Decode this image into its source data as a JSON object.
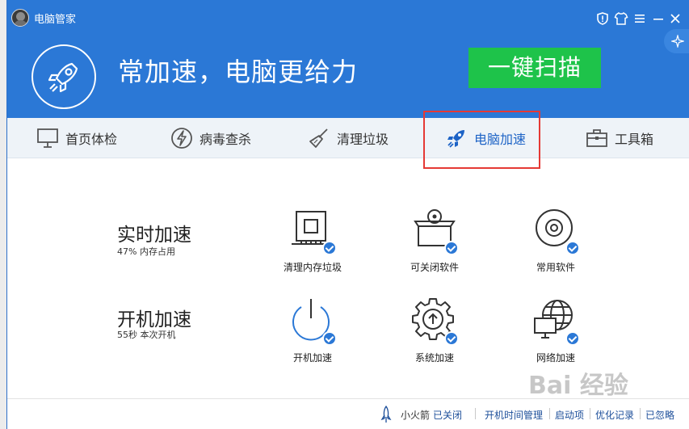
{
  "titlebar": {
    "title": "电脑管家"
  },
  "hero": {
    "slogan": "常加速，电脑更给力",
    "scan_button": "一键扫描"
  },
  "nav": {
    "items": [
      {
        "label": "首页体检",
        "icon": "monitor-icon"
      },
      {
        "label": "病毒查杀",
        "icon": "lightning-icon"
      },
      {
        "label": "清理垃圾",
        "icon": "broom-icon"
      },
      {
        "label": "电脑加速",
        "icon": "rocket-icon",
        "active": true
      },
      {
        "label": "工具箱",
        "icon": "toolbox-icon"
      }
    ]
  },
  "realtime": {
    "title": "实时加速",
    "subtitle": "47% 内存占用"
  },
  "boot": {
    "title": "开机加速",
    "subtitle": "55秒 本次开机"
  },
  "tools": [
    {
      "label": "清理内存垃圾",
      "icon": "memory-chip-icon"
    },
    {
      "label": "可关闭软件",
      "icon": "software-box-icon"
    },
    {
      "label": "常用软件",
      "icon": "disc-icon"
    },
    {
      "label": "开机加速",
      "icon": "power-icon"
    },
    {
      "label": "系统加速",
      "icon": "gear-icon"
    },
    {
      "label": "网络加速",
      "icon": "globe-monitor-icon"
    }
  ],
  "footer": {
    "rocket_label": "小火箭",
    "rocket_status": "已关闭",
    "boot_time": "开机时间管理",
    "startup": "启动项",
    "optimize_log": "优化记录",
    "ignored": "已忽略"
  },
  "watermark": {
    "text": "Bai 经验"
  },
  "colors": {
    "header": "#2b78d6",
    "accent_green": "#1ec34a",
    "highlight_box": "#e53935"
  }
}
